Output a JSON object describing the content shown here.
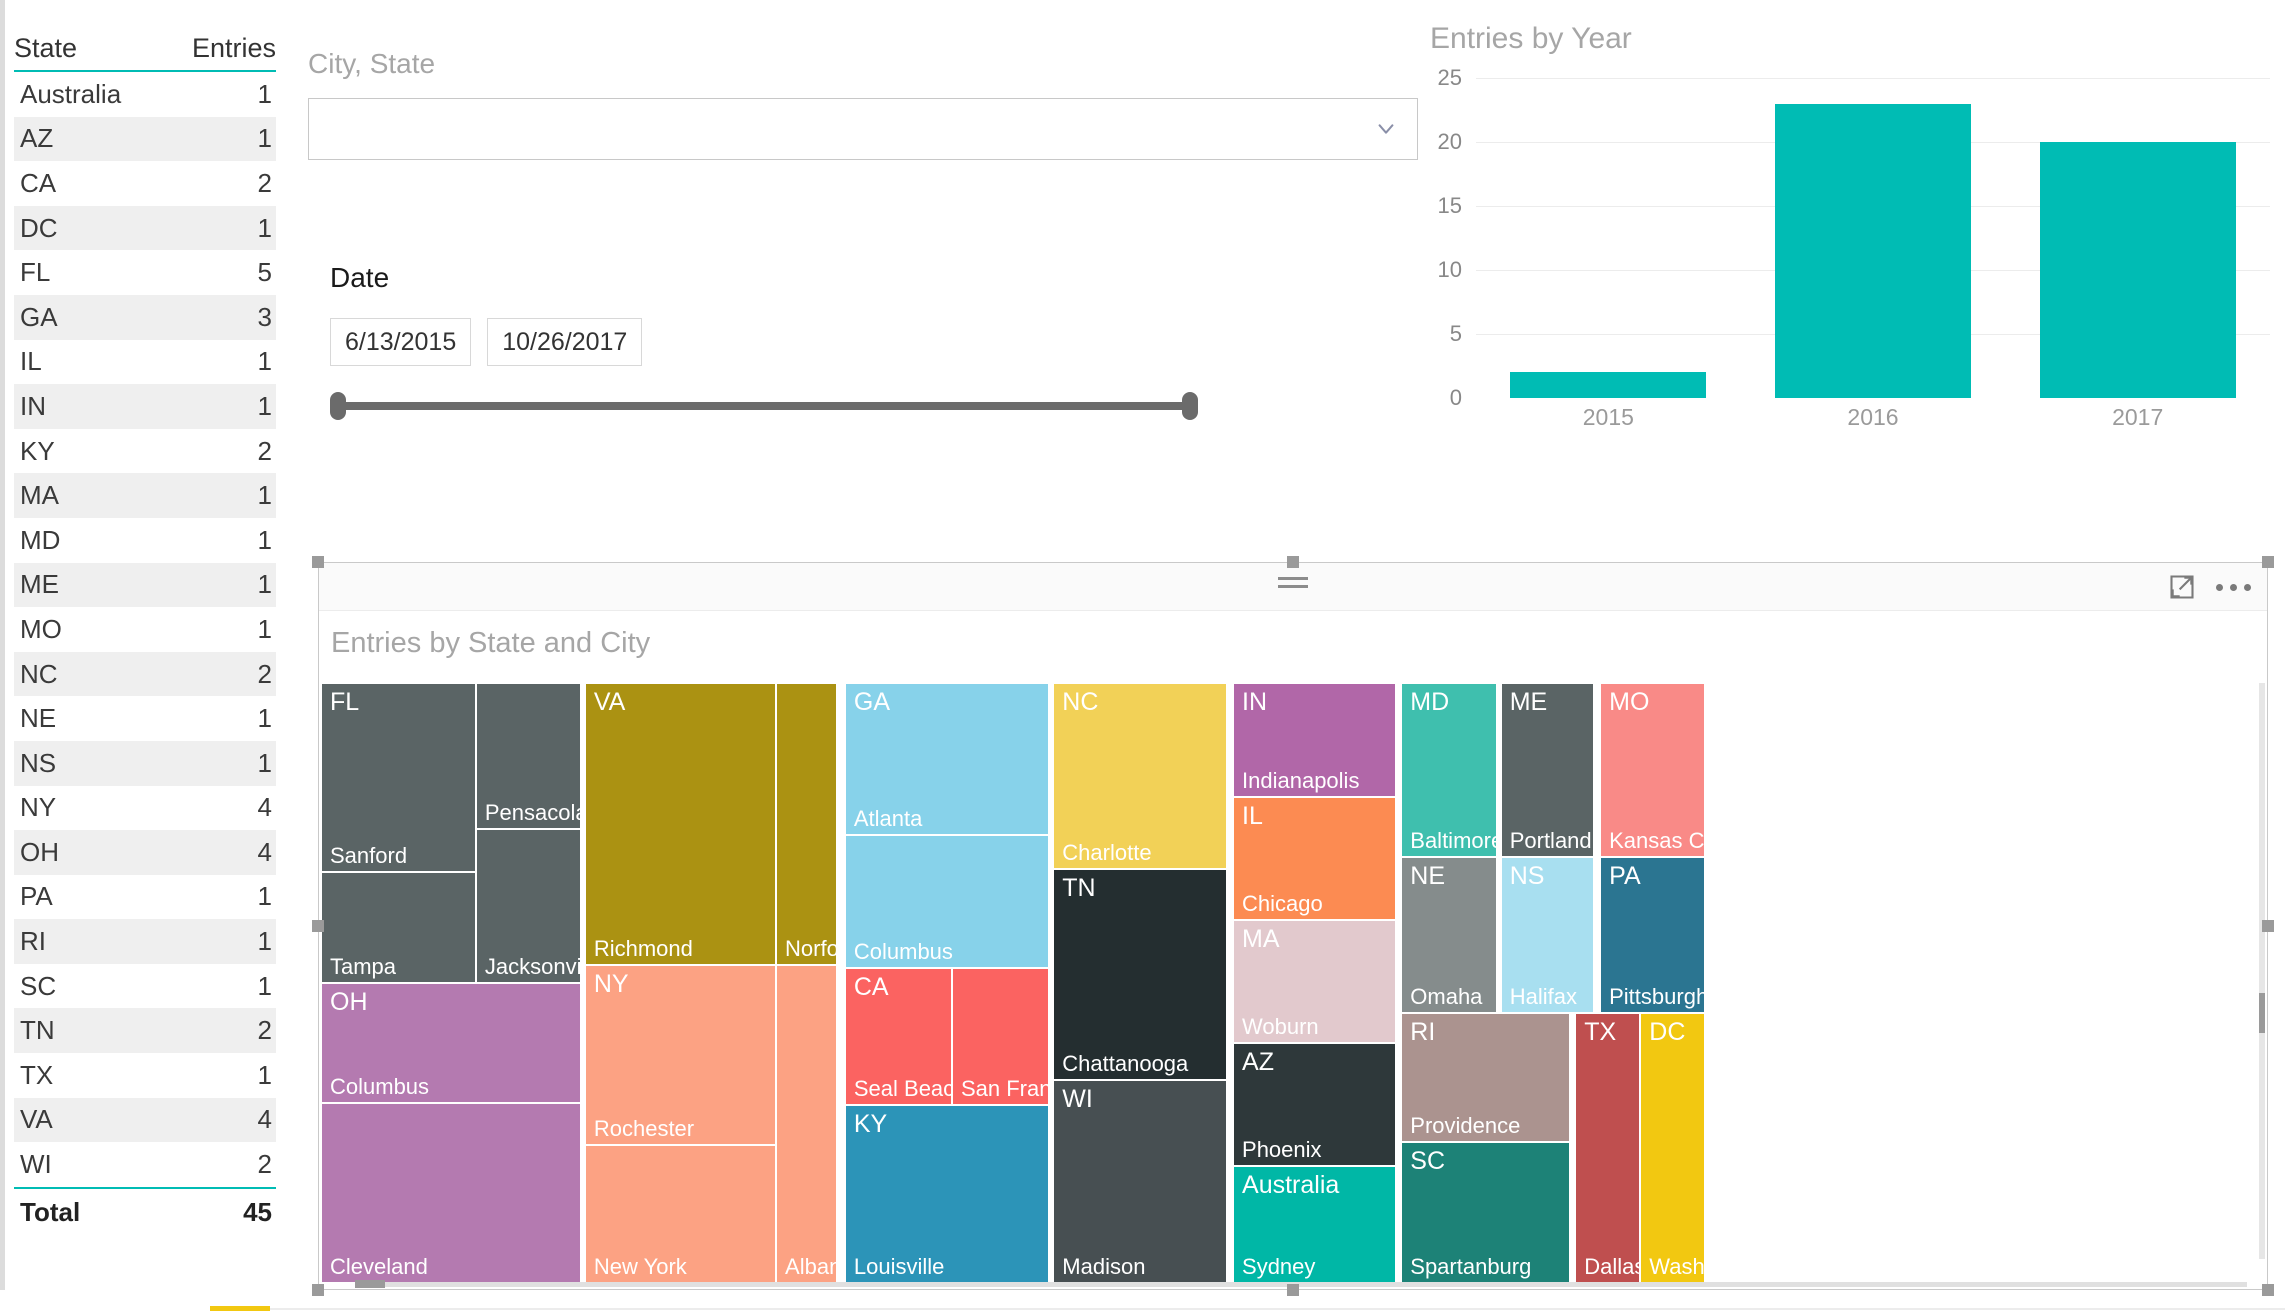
{
  "state_table": {
    "columns": [
      "State",
      "Entries"
    ],
    "rows": [
      {
        "state": "Australia",
        "entries": "1"
      },
      {
        "state": "AZ",
        "entries": "1"
      },
      {
        "state": "CA",
        "entries": "2"
      },
      {
        "state": "DC",
        "entries": "1"
      },
      {
        "state": "FL",
        "entries": "5"
      },
      {
        "state": "GA",
        "entries": "3"
      },
      {
        "state": "IL",
        "entries": "1"
      },
      {
        "state": "IN",
        "entries": "1"
      },
      {
        "state": "KY",
        "entries": "2"
      },
      {
        "state": "MA",
        "entries": "1"
      },
      {
        "state": "MD",
        "entries": "1"
      },
      {
        "state": "ME",
        "entries": "1"
      },
      {
        "state": "MO",
        "entries": "1"
      },
      {
        "state": "NC",
        "entries": "2"
      },
      {
        "state": "NE",
        "entries": "1"
      },
      {
        "state": "NS",
        "entries": "1"
      },
      {
        "state": "NY",
        "entries": "4"
      },
      {
        "state": "OH",
        "entries": "4"
      },
      {
        "state": "PA",
        "entries": "1"
      },
      {
        "state": "RI",
        "entries": "1"
      },
      {
        "state": "SC",
        "entries": "1"
      },
      {
        "state": "TN",
        "entries": "2"
      },
      {
        "state": "TX",
        "entries": "1"
      },
      {
        "state": "VA",
        "entries": "4"
      },
      {
        "state": "WI",
        "entries": "2"
      }
    ],
    "total_label": "Total",
    "total_value": "45",
    "accent_color": "#00bcb4"
  },
  "city_state_slicer": {
    "label": "City, State",
    "value": "",
    "placeholder": "",
    "chevron": "chevron-down-icon"
  },
  "date_slicer": {
    "label": "Date",
    "start": "6/13/2015",
    "end": "10/26/2017"
  },
  "chart_data": {
    "type": "bar",
    "title": "Entries by Year",
    "categories": [
      "2015",
      "2016",
      "2017"
    ],
    "values": [
      2,
      23,
      20
    ],
    "xlabel": "",
    "ylabel": "",
    "ylim": [
      0,
      25
    ],
    "yticks": [
      25,
      20,
      15,
      10,
      5,
      0
    ],
    "grid": true,
    "legend": "none",
    "series_color": "#00bcb4"
  },
  "treemap": {
    "title": "Entries by State and City",
    "focus_icon": "focus-mode-icon",
    "more_icon": "more-options-icon",
    "tiles": [
      {
        "state": "FL",
        "city": "Sanford",
        "color": "#5a6465"
      },
      {
        "state": "",
        "city": "Tampa",
        "color": "#5a6465"
      },
      {
        "state": "",
        "city": "Pensacola",
        "color": "#5a6465"
      },
      {
        "state": "",
        "city": "Jacksonville",
        "color": "#5a6465"
      },
      {
        "state": "OH",
        "city": "Columbus",
        "color": "#b47ab0"
      },
      {
        "state": "",
        "city": "Cleveland",
        "color": "#b47ab0"
      },
      {
        "state": "VA",
        "city": "Richmond",
        "color": "#ab9212"
      },
      {
        "state": "",
        "city": "Norfolk",
        "color": "#ab9212"
      },
      {
        "state": "NY",
        "city": "Rochester",
        "color": "#fca283"
      },
      {
        "state": "",
        "city": "New York",
        "color": "#fca283"
      },
      {
        "state": "",
        "city": "Albany",
        "color": "#fca283"
      },
      {
        "state": "GA",
        "city": "Atlanta",
        "color": "#87d2ea"
      },
      {
        "state": "",
        "city": "Columbus",
        "color": "#87d2ea"
      },
      {
        "state": "CA",
        "city": "Seal Beach",
        "color": "#fb6361"
      },
      {
        "state": "",
        "city": "San Francisco",
        "color": "#fb6361"
      },
      {
        "state": "KY",
        "city": "Louisville",
        "color": "#2c94b8"
      },
      {
        "state": "NC",
        "city": "Charlotte",
        "color": "#f2d157"
      },
      {
        "state": "TN",
        "city": "Chattanooga",
        "color": "#242e30"
      },
      {
        "state": "WI",
        "city": "Madison",
        "color": "#474f52"
      },
      {
        "state": "IN",
        "city": "Indianapolis",
        "color": "#b167a8"
      },
      {
        "state": "IL",
        "city": "Chicago",
        "color": "#fc8b52"
      },
      {
        "state": "MA",
        "city": "Woburn",
        "color": "#e2c9cd"
      },
      {
        "state": "AZ",
        "city": "Phoenix",
        "color": "#2e383a"
      },
      {
        "state": "Australia",
        "city": "Sydney",
        "color": "#00b7a6"
      },
      {
        "state": "MD",
        "city": "Baltimore",
        "color": "#3fbfae"
      },
      {
        "state": "NE",
        "city": "Omaha",
        "color": "#858c8c"
      },
      {
        "state": "RI",
        "city": "Providence",
        "color": "#ab938f"
      },
      {
        "state": "SC",
        "city": "Spartanburg",
        "color": "#1d8277"
      },
      {
        "state": "ME",
        "city": "Portland",
        "color": "#5a6465"
      },
      {
        "state": "NS",
        "city": "Halifax",
        "color": "#a8dff0"
      },
      {
        "state": "MO",
        "city": "Kansas City",
        "color": "#f98a87"
      },
      {
        "state": "PA",
        "city": "Pittsburgh",
        "color": "#2b7591"
      },
      {
        "state": "TX",
        "city": "Dallas",
        "color": "#bf4f4f"
      },
      {
        "state": "DC",
        "city": "Washingt...",
        "color": "#f2c811"
      }
    ]
  }
}
